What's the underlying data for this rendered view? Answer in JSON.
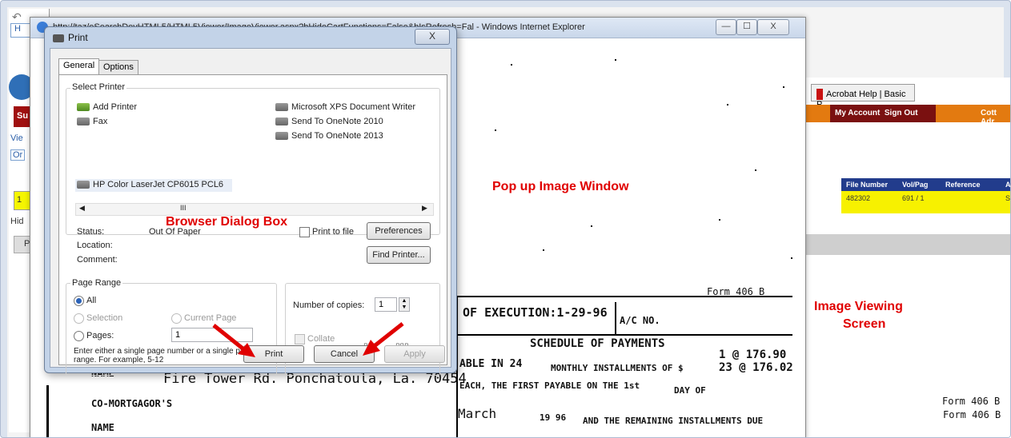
{
  "background_app": {
    "tab_label": "H",
    "bar_text": "Su",
    "side_labels": [
      "Vie",
      "Or",
      "S",
      "1",
      "Hid",
      "P"
    ],
    "acrobat_tab": "Acrobat Help | Basic P...",
    "account": "My Account",
    "sign_out": "Sign Out",
    "user": "Cott Adr",
    "table_headers": [
      "File Number",
      "Vol/Pag",
      "Reference",
      "A"
    ],
    "table_row": [
      "482302",
      "691 / 1",
      "",
      "S"
    ]
  },
  "popup": {
    "title": "http://taz/eSearchDevHTML5/HTML5Viewer/ImageViewer.aspx?bHideCartFunctions=False&bIsRefresh=Fal - Windows Internet Explorer",
    "minimize": "—",
    "maximize": "☐",
    "close": "X"
  },
  "document": {
    "form_label": "Form 406 B",
    "execution": "OF EXECUTION:1-29-96",
    "ac_no": "A/C NO.",
    "schedule": "SCHEDULE OF PAYMENTS",
    "payable": "ABLE IN 24",
    "installments": "MONTHLY INSTALLMENTS OF $",
    "amount1": "1 @ 176.90",
    "amount2": "23 @ 176.02",
    "name_label": "NAME",
    "address": "Fire Tower Rd. Ponchatoula, La. 70454",
    "each": "EACH, THE FIRST PAYABLE ON THE 1st",
    "day_of": "DAY OF",
    "co_mortgagor": "CO-MORTGAGOR'S",
    "name2": "NAME",
    "march": "March",
    "year": "19 96",
    "remaining": "AND THE REMAINING INSTALLMENTS DUE",
    "form_label2": "Form 406 B"
  },
  "annotations": {
    "popup_label": "Pop up Image Window",
    "dialog_label": "Browser Dialog Box",
    "viewing_label_line1": "Image Viewing",
    "viewing_label_line2": "Screen"
  },
  "print_dialog": {
    "title": "Print",
    "close": "X",
    "tabs": [
      "General",
      "Options"
    ],
    "select_printer_label": "Select Printer",
    "printers_left": [
      "Add Printer",
      "Fax",
      "HP Color LaserJet CP6015 PCL6"
    ],
    "printers_right": [
      "Microsoft XPS Document Writer",
      "Send To OneNote 2010",
      "Send To OneNote 2013"
    ],
    "scroll_thumb": "III",
    "status_label": "Status:",
    "status_value": "Out Of Paper",
    "location_label": "Location:",
    "comment_label": "Comment:",
    "print_to_file": "Print to file",
    "preferences": "Preferences",
    "find_printer": "Find Printer...",
    "page_range_label": "Page Range",
    "range_all": "All",
    "range_selection": "Selection",
    "range_current": "Current Page",
    "range_pages": "Pages:",
    "pages_value": "1",
    "hint": "Enter either a single page number or a single page range.  For example, 5-12",
    "copies_label": "Number of copies:",
    "copies_value": "1",
    "collate": "Collate",
    "print_btn": "Print",
    "cancel_btn": "Cancel",
    "apply_btn": "Apply"
  },
  "colors": {
    "annotation_red": "#e00000",
    "header_red": "#a01010",
    "highlight_yellow": "#f5f500",
    "table_header_blue": "#223c8c"
  }
}
